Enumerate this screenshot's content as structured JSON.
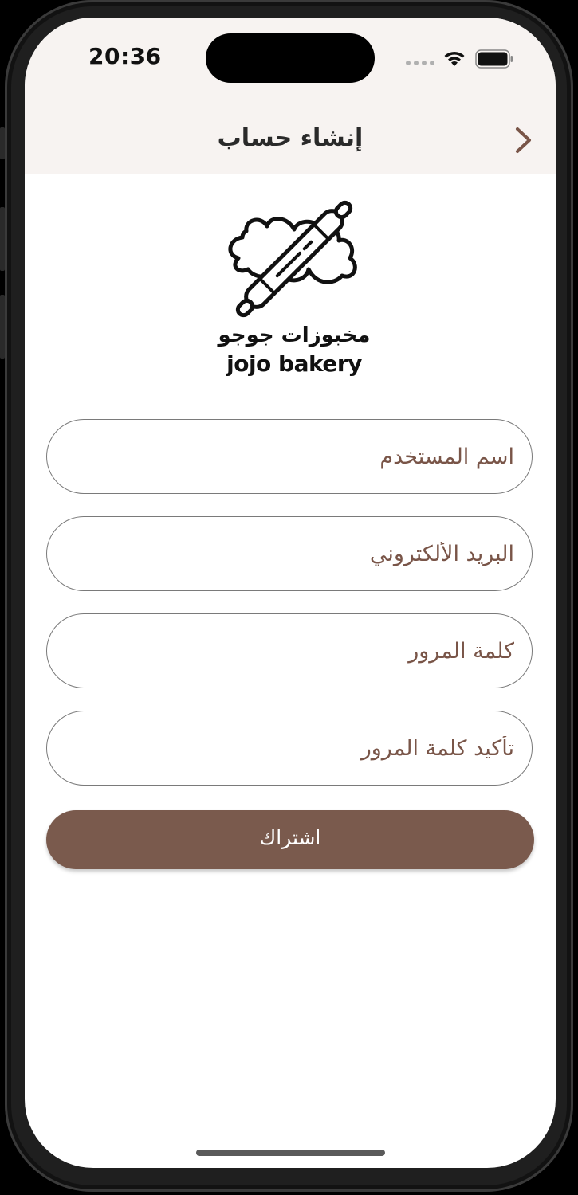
{
  "status_bar": {
    "time": "20:36"
  },
  "nav": {
    "title": "إنشاء حساب",
    "back_icon": "chevron-right-icon"
  },
  "logo": {
    "name_ar": "مخبوزات جوجو",
    "name_en": "jojo bakery",
    "icon": "rolling-pin-dough-icon"
  },
  "form": {
    "username_placeholder": "اسم المستخدم",
    "email_placeholder": "البريد الألكتروني",
    "password_placeholder": "كلمة المرور",
    "confirm_password_placeholder": "تأكيد كلمة المرور",
    "submit_label": "اشتراك"
  },
  "colors": {
    "accent": "#7a5a4d",
    "placeholder": "#795548",
    "header_bg": "#f7f3f1"
  }
}
